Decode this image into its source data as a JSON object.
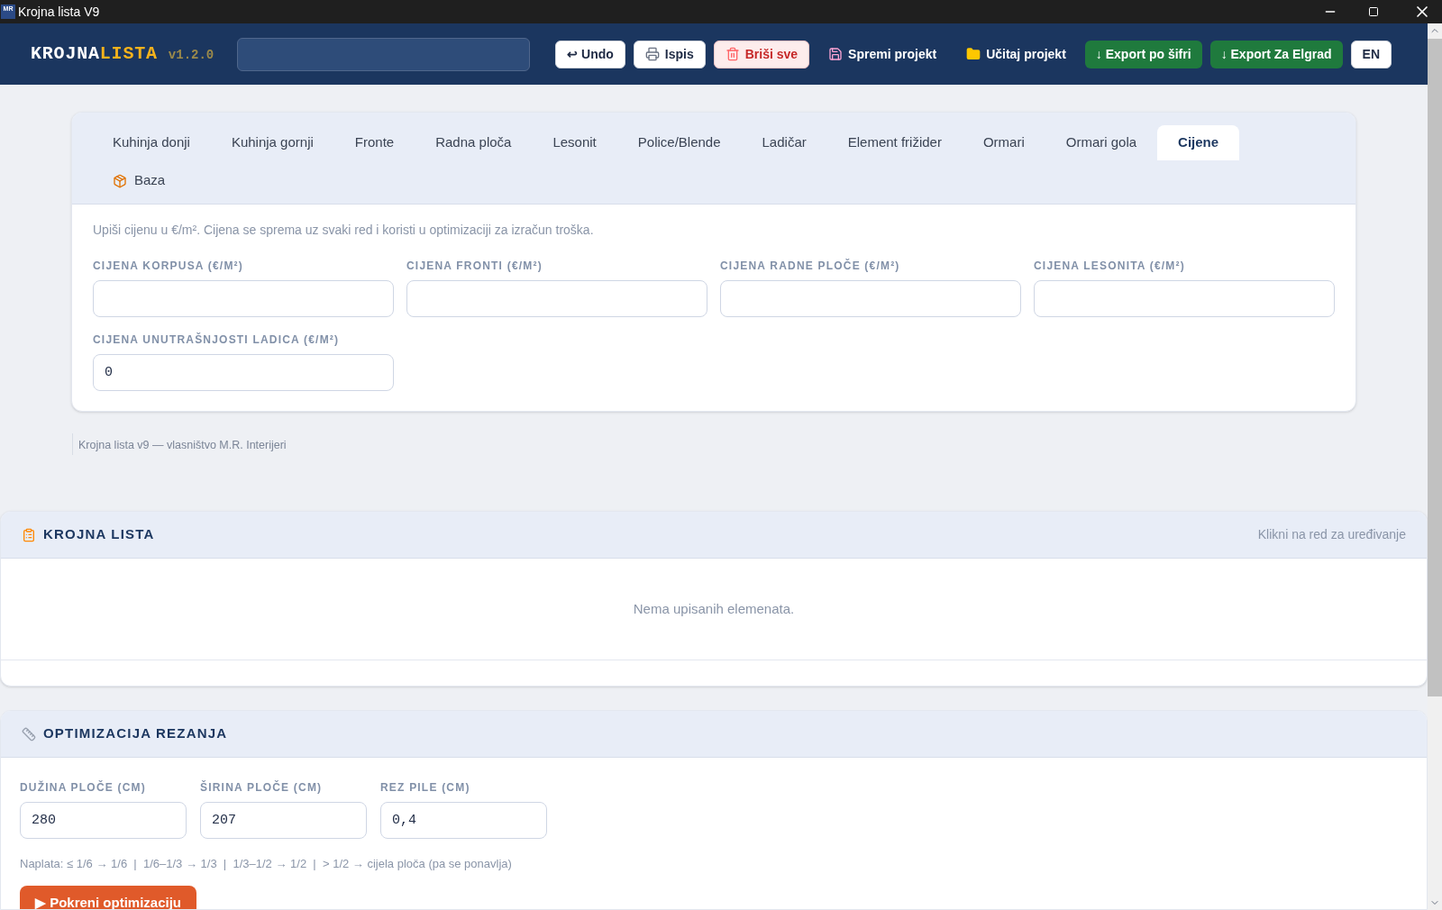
{
  "window": {
    "app_icon_text": "MR",
    "title": "Krojna lista V9"
  },
  "header": {
    "logo": {
      "part_1": "KROJNA",
      "part_2": "LISTA",
      "version": "v1.2.0"
    },
    "buttons": [
      {
        "label": "↩ Undo",
        "kind": "light"
      },
      {
        "label": "Ispis",
        "kind": "light"
      },
      {
        "label": "Briši sve",
        "kind": "danger"
      },
      {
        "label": "Spremi projekt",
        "kind": "plain"
      },
      {
        "label": "Učitaj projekt",
        "kind": "plain"
      },
      {
        "label": "↓ Export po šifri",
        "kind": "success"
      },
      {
        "label": "↓ Export Za Elgrad",
        "kind": "success"
      },
      {
        "label": "EN",
        "kind": "light"
      }
    ]
  },
  "tabs": [
    {
      "label": "Kuhinja donji",
      "selected": false
    },
    {
      "label": "Kuhinja gornji",
      "selected": false
    },
    {
      "label": "Fronte",
      "selected": false
    },
    {
      "label": "Radna ploča",
      "selected": false
    },
    {
      "label": "Lesonit",
      "selected": false
    },
    {
      "label": "Police/Blende",
      "selected": false
    },
    {
      "label": "Ladičar",
      "selected": false
    },
    {
      "label": "Element frižider",
      "selected": false
    },
    {
      "label": "Ormari",
      "selected": false
    },
    {
      "label": "Ormari gola",
      "selected": false
    },
    {
      "label": "Cijene",
      "selected": true
    },
    {
      "label": "Baza",
      "selected": false
    }
  ],
  "prices": {
    "hint": "Upiši cijenu u €/m². Cijena se sprema uz svaki red i koristi u optimizaciji za izračun troška.",
    "fields": [
      {
        "label": "CIJENA KORPUSA (€/M²)"
      },
      {
        "label": "CIJENA FRONTI (€/M²)"
      },
      {
        "label": "CIJENA RADNE PLOČE (€/M²)"
      },
      {
        "label": "CIJENA LESONITA (€/M²)"
      },
      {
        "label": "CIJENA UNUTRAŠNJOSTI LADICA (€/M²)",
        "value": "0"
      }
    ]
  },
  "footer": "Krojna lista v9 — vlasništvo M.R. Interijeri",
  "cut_list": {
    "title": "KROJNA LISTA",
    "hint": "Klikni na red za uređivanje",
    "empty": "Nema upisanih elemenata."
  },
  "optimization": {
    "title": "OPTIMIZACIJA REZANJA",
    "fields": [
      {
        "label": "DUŽINA PLOČE (CM)",
        "value": "280"
      },
      {
        "label": "ŠIRINA PLOČE (CM)",
        "value": "207"
      },
      {
        "label": "REZ PILE (CM)",
        "value": "0,4"
      }
    ],
    "billing_note": "Naplata: ≤ 1/6 → 1/6  |  1/6–1/3 → 1/3  |  1/3–1/2 → 1/2  |  > 1/2 → cijela ploča (pa se ponavlja)",
    "run_button": "▶ Pokreni optimizaciju"
  }
}
